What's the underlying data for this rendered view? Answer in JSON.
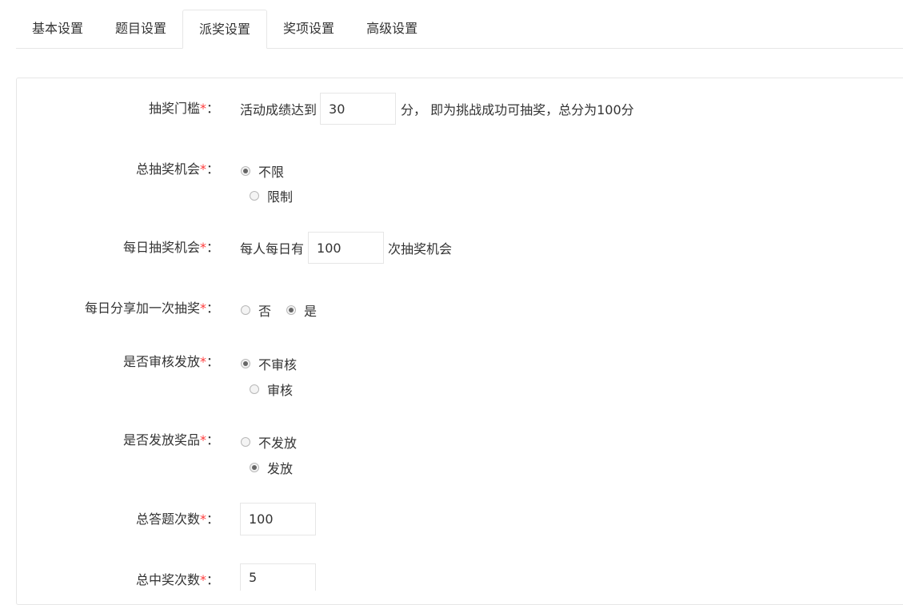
{
  "tabs": [
    {
      "label": "基本设置",
      "active": false
    },
    {
      "label": "题目设置",
      "active": false
    },
    {
      "label": "派奖设置",
      "active": true
    },
    {
      "label": "奖项设置",
      "active": false
    },
    {
      "label": "高级设置",
      "active": false
    }
  ],
  "required_mark": "*",
  "colon": "：",
  "threshold": {
    "label": "抽奖门槛",
    "prefix": "活动成绩达到",
    "value": "30",
    "suffix": "分， 即为挑战成功可抽奖，总分为100分"
  },
  "total_chances": {
    "label": "总抽奖机会",
    "options": [
      {
        "label": "不限",
        "checked": true
      },
      {
        "label": "限制",
        "checked": false
      }
    ]
  },
  "daily_chances": {
    "label": "每日抽奖机会",
    "prefix": "每人每日有",
    "value": "100",
    "suffix": "次抽奖机会"
  },
  "daily_share": {
    "label": "每日分享加一次抽奖",
    "options": [
      {
        "label": "否",
        "checked": false
      },
      {
        "label": "是",
        "checked": true
      }
    ]
  },
  "review": {
    "label": "是否审核发放",
    "options": [
      {
        "label": "不审核",
        "checked": true
      },
      {
        "label": "审核",
        "checked": false
      }
    ]
  },
  "prize_delivery": {
    "label": "是否发放奖品",
    "options": [
      {
        "label": "不发放",
        "checked": false
      },
      {
        "label": "发放",
        "checked": true
      }
    ]
  },
  "total_answers": {
    "label": "总答题次数",
    "value": "100"
  },
  "total_wins": {
    "label": "总中奖次数",
    "value": "5"
  }
}
